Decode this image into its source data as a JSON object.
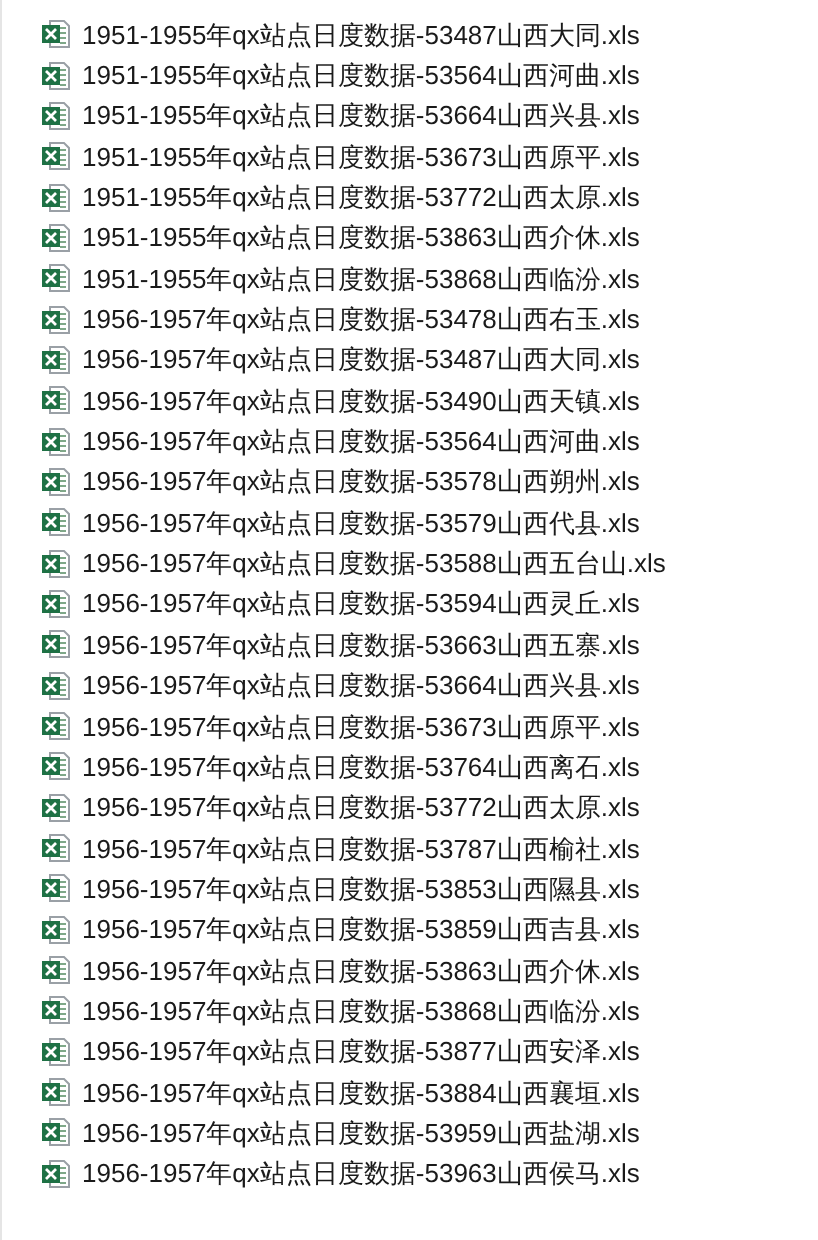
{
  "files": [
    {
      "name": "1951-1955年qx站点日度数据-53487山西大同.xls"
    },
    {
      "name": "1951-1955年qx站点日度数据-53564山西河曲.xls"
    },
    {
      "name": "1951-1955年qx站点日度数据-53664山西兴县.xls"
    },
    {
      "name": "1951-1955年qx站点日度数据-53673山西原平.xls"
    },
    {
      "name": "1951-1955年qx站点日度数据-53772山西太原.xls"
    },
    {
      "name": "1951-1955年qx站点日度数据-53863山西介休.xls"
    },
    {
      "name": "1951-1955年qx站点日度数据-53868山西临汾.xls"
    },
    {
      "name": "1956-1957年qx站点日度数据-53478山西右玉.xls"
    },
    {
      "name": "1956-1957年qx站点日度数据-53487山西大同.xls"
    },
    {
      "name": "1956-1957年qx站点日度数据-53490山西天镇.xls"
    },
    {
      "name": "1956-1957年qx站点日度数据-53564山西河曲.xls"
    },
    {
      "name": "1956-1957年qx站点日度数据-53578山西朔州.xls"
    },
    {
      "name": "1956-1957年qx站点日度数据-53579山西代县.xls"
    },
    {
      "name": "1956-1957年qx站点日度数据-53588山西五台山.xls"
    },
    {
      "name": "1956-1957年qx站点日度数据-53594山西灵丘.xls"
    },
    {
      "name": "1956-1957年qx站点日度数据-53663山西五寨.xls"
    },
    {
      "name": "1956-1957年qx站点日度数据-53664山西兴县.xls"
    },
    {
      "name": "1956-1957年qx站点日度数据-53673山西原平.xls"
    },
    {
      "name": "1956-1957年qx站点日度数据-53764山西离石.xls"
    },
    {
      "name": "1956-1957年qx站点日度数据-53772山西太原.xls"
    },
    {
      "name": "1956-1957年qx站点日度数据-53787山西榆社.xls"
    },
    {
      "name": "1956-1957年qx站点日度数据-53853山西隰县.xls"
    },
    {
      "name": "1956-1957年qx站点日度数据-53859山西吉县.xls"
    },
    {
      "name": "1956-1957年qx站点日度数据-53863山西介休.xls"
    },
    {
      "name": "1956-1957年qx站点日度数据-53868山西临汾.xls"
    },
    {
      "name": "1956-1957年qx站点日度数据-53877山西安泽.xls"
    },
    {
      "name": "1956-1957年qx站点日度数据-53884山西襄垣.xls"
    },
    {
      "name": "1956-1957年qx站点日度数据-53959山西盐湖.xls"
    },
    {
      "name": "1956-1957年qx站点日度数据-53963山西侯马.xls"
    }
  ]
}
